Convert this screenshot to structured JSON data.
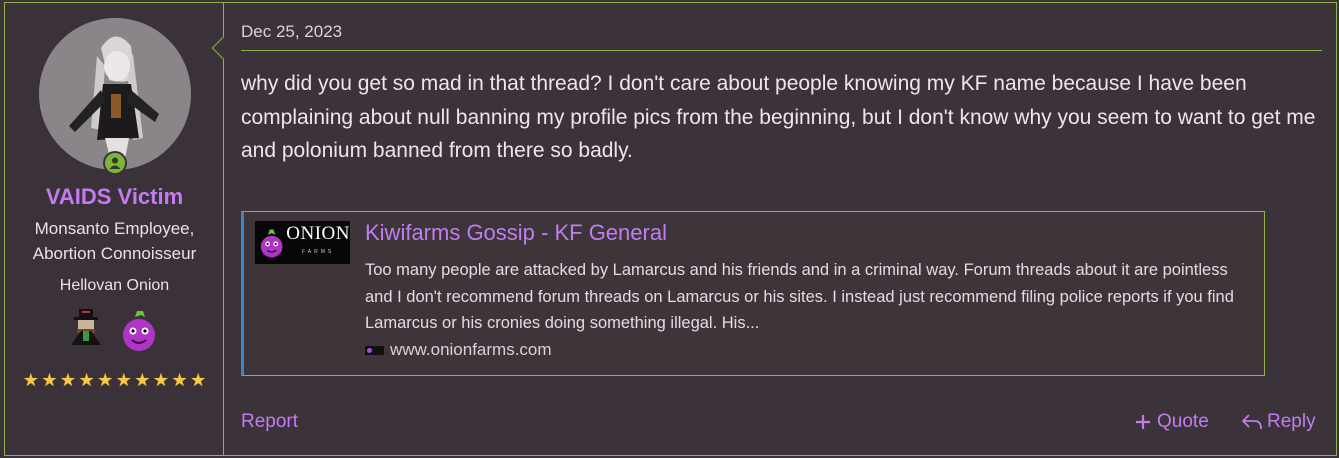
{
  "user": {
    "name": "VAIDS Victim",
    "title_line1": "Monsanto Employee,",
    "title_line2": "Abortion Connoisseur",
    "rank": "Hellovan Onion",
    "stars": [
      "★",
      "★",
      "★",
      "★",
      "★",
      "★",
      "★",
      "★",
      "★",
      "★"
    ],
    "online_icon": "user-online-icon",
    "badges": [
      "gentleman-badge-icon",
      "purple-onion-badge-icon"
    ]
  },
  "post": {
    "date": "Dec 25, 2023",
    "message": "why did you get so mad in that thread? I don't care about people knowing my KF name because I have been complaining about null banning my profile pics from the beginning, but I don't know why you seem to want to get me and polonium banned from there so badly."
  },
  "embed": {
    "logo_text": "ONION",
    "logo_sub": "FARMS",
    "title": "Kiwifarms Gossip - KF General",
    "description": "Too many people are attacked by Lamarcus and his friends and in a criminal way. Forum threads about it are pointless and I don't recommend forum threads on Lamarcus or his sites. I instead just recommend filing police reports if you find Lamarcus or his cronies doing something illegal. His...",
    "url": "www.onionfarms.com"
  },
  "actions": {
    "report": "Report",
    "quote": "Quote",
    "reply": "Reply"
  },
  "colors": {
    "accent": "#c17df0",
    "border": "#8fb24a",
    "background": "#3b3339",
    "embed_bar": "#3a86c8"
  }
}
